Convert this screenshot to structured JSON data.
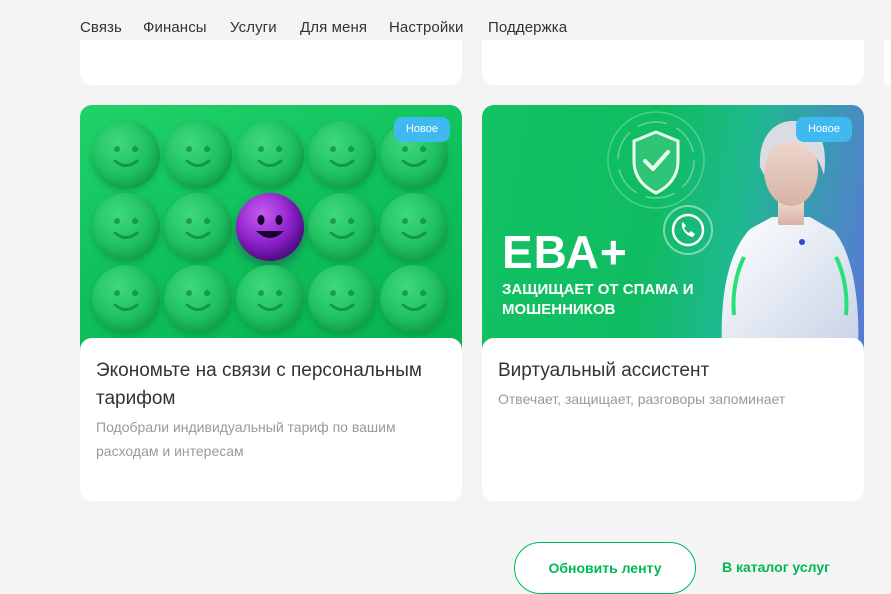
{
  "nav": {
    "items": [
      {
        "label": "Связь"
      },
      {
        "label": "Финансы"
      },
      {
        "label": "Услуги"
      },
      {
        "label": "Для меня",
        "active": true
      },
      {
        "label": "Настройки"
      },
      {
        "label": "Поддержка"
      }
    ]
  },
  "cards": [
    {
      "badge": "Новое",
      "title": "Экономьте на связи с персональным тарифом",
      "description": "Подобрали индивидуальный тариф по вашим расходам и интересам",
      "image": "green-smiley-grid-with-purple-smiley"
    },
    {
      "badge": "Новое",
      "title": "Виртуальный ассистент",
      "description": "Отвечает, защищает, разговоры запоминает",
      "image": {
        "headline": "ЕВА+",
        "subline": "ЗАЩИЩАЕТ ОТ СПАМА И МОШЕННИКОВ"
      }
    }
  ],
  "actions": {
    "refresh_label": "Обновить ленту",
    "catalog_label": "В каталог услуг"
  },
  "colors": {
    "accent": "#00b956",
    "badge": "#3fb9f0",
    "background": "#f4f4f4"
  }
}
